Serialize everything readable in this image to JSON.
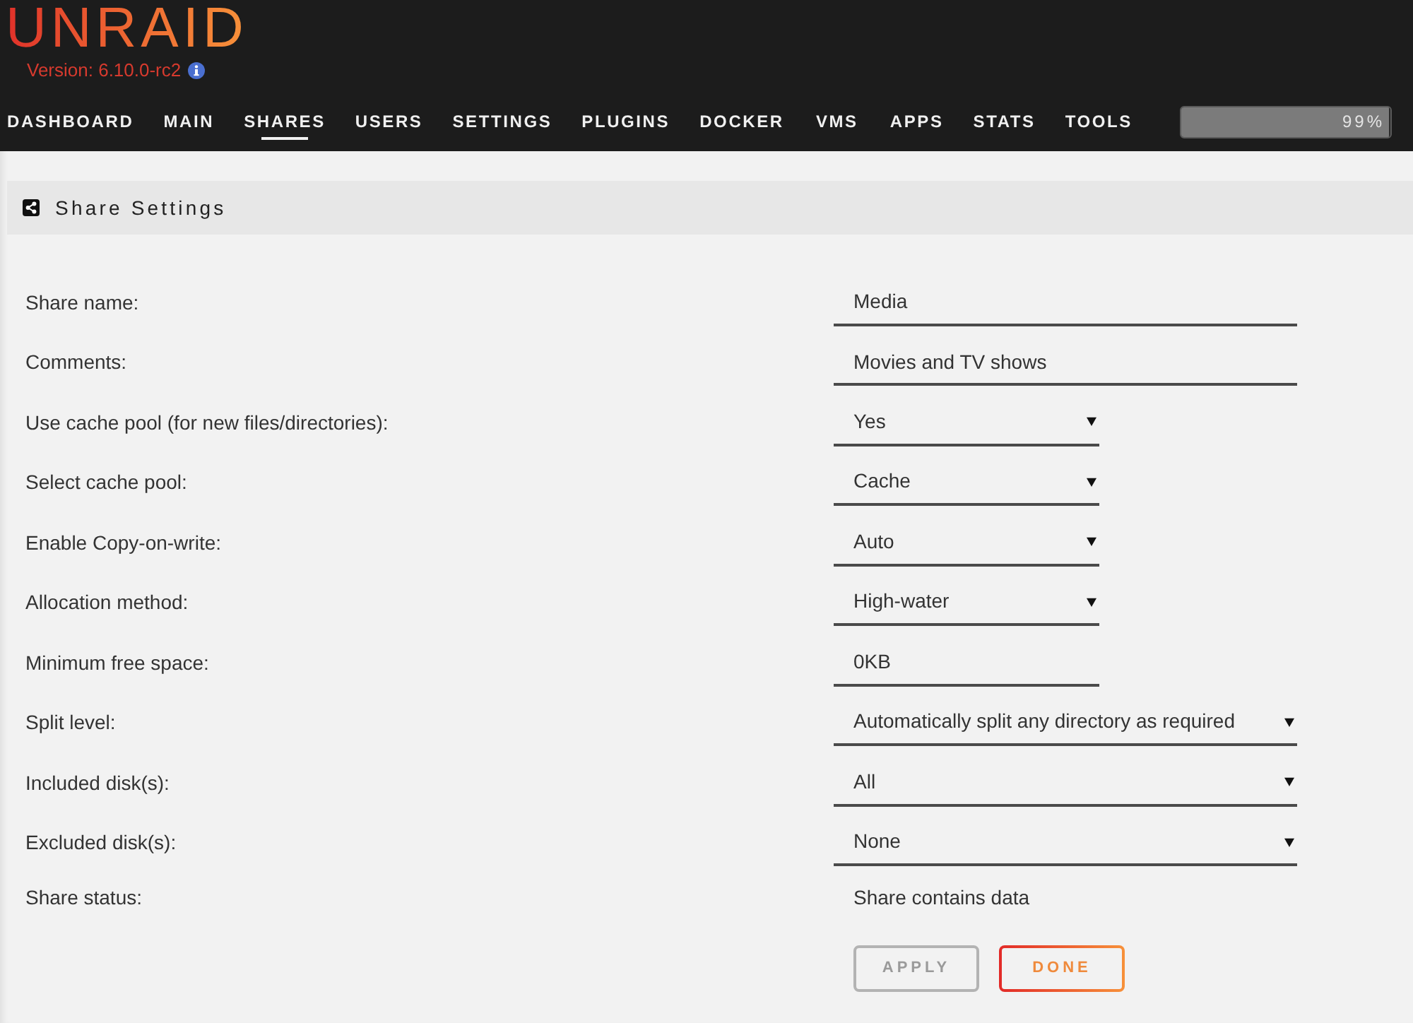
{
  "header": {
    "logo": "UNRAID",
    "version": "Version: 6.10.0-rc2"
  },
  "nav": [
    {
      "label": "DASHBOARD",
      "selected": false
    },
    {
      "label": "MAIN",
      "selected": false
    },
    {
      "label": "SHARES",
      "selected": true
    },
    {
      "label": "USERS",
      "selected": false
    },
    {
      "label": "SETTINGS",
      "selected": false
    },
    {
      "label": "PLUGINS",
      "selected": false
    },
    {
      "label": "DOCKER",
      "selected": false
    },
    {
      "label": "VMS",
      "selected": false
    },
    {
      "label": "APPS",
      "selected": false
    },
    {
      "label": "STATS",
      "selected": false
    },
    {
      "label": "TOOLS",
      "selected": false
    }
  ],
  "usage_meter": {
    "level": 0.99,
    "reading": "99%"
  },
  "panel": {
    "title": "Share Settings"
  },
  "fields": [
    {
      "label": "Share name:",
      "kind": "text",
      "value": "Media"
    },
    {
      "label": "Comments:",
      "kind": "text",
      "value": "Movies and TV shows"
    },
    {
      "label": "Use cache pool (for new files/directories):",
      "kind": "select",
      "value": "Yes"
    },
    {
      "label": "Select cache pool:",
      "kind": "select",
      "value": "Cache"
    },
    {
      "label": "Enable Copy-on-write:",
      "kind": "select",
      "value": "Auto"
    },
    {
      "label": "Allocation method:",
      "kind": "select",
      "value": "High-water"
    },
    {
      "label": "Minimum free space:",
      "kind": "shorttext",
      "value": "0KB"
    },
    {
      "label": "Split level:",
      "kind": "wideselect",
      "value": "Automatically split any directory as required"
    },
    {
      "label": "Included disk(s):",
      "kind": "wideselect",
      "value": "All"
    },
    {
      "label": "Excluded disk(s):",
      "kind": "wideselect",
      "value": "None"
    },
    {
      "label": "Share status:",
      "kind": "status",
      "value": "Share contains data"
    }
  ],
  "buttons": [
    {
      "label": "APPLY",
      "disabled": true
    },
    {
      "label": "DONE",
      "disabled": false
    }
  ]
}
